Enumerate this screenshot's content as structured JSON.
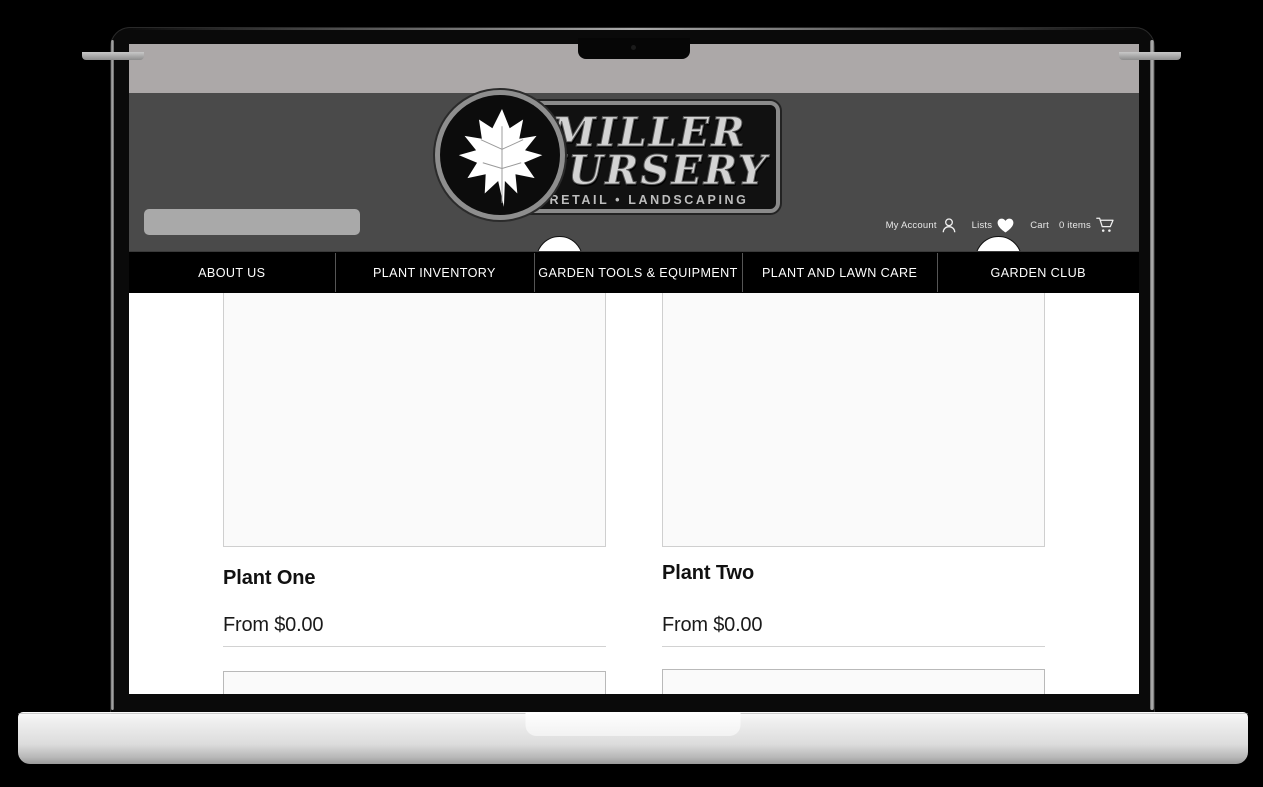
{
  "device": {
    "type": "laptop",
    "notch_camera": "camera-dot"
  },
  "site": {
    "logo": {
      "line1": "MILLER",
      "line2": "NURSERY",
      "tagline": "RETAIL • LANDSCAPING",
      "emblem": "maple-leaf-icon"
    },
    "search": {
      "value": "",
      "placeholder": ""
    },
    "account_bar": [
      {
        "label": "My Account",
        "icon": "user-icon"
      },
      {
        "label": "Lists",
        "icon": "heart-icon"
      },
      {
        "label": "Cart",
        "icon": null
      },
      {
        "label": "0 items",
        "icon": "cart-icon"
      }
    ],
    "nav": [
      {
        "label": "ABOUT US"
      },
      {
        "label": "PLANT INVENTORY"
      },
      {
        "label": "GARDEN TOOLS & EQUIPMENT"
      },
      {
        "label": "PLANT AND LAWN CARE"
      },
      {
        "label": "GARDEN CLUB"
      }
    ],
    "products": [
      {
        "title": "Plant One",
        "price": "From $0.00",
        "wishlist_icon": "wishlist-circle-icon"
      },
      {
        "title": "Plant Two",
        "price": "From $0.00",
        "wishlist_icon": "wishlist-circle-icon"
      }
    ]
  },
  "colors": {
    "top_band": "#aca8a8",
    "header_bg": "#4a4a4a",
    "nav_bg": "#000000",
    "page_bg": "#ffffff",
    "search_bg": "#a9a9a9",
    "text_light": "#ffffff",
    "text_dark": "#111111",
    "card_border": "#cfcfcf",
    "device_black": "#0a0a0a",
    "device_silver": "#dcdcdc"
  }
}
